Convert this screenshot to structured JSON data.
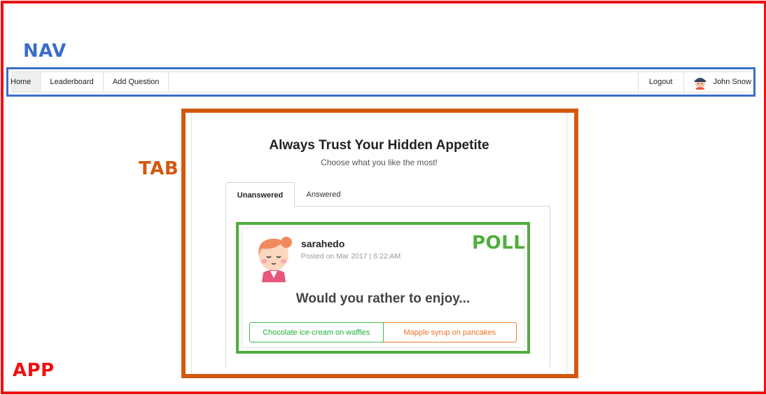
{
  "annotations": {
    "nav": "NAV",
    "tab": "TAB",
    "poll": "POLL",
    "app": "APP"
  },
  "nav": {
    "items": [
      {
        "label": "Home",
        "active": true
      },
      {
        "label": "Leaderboard"
      },
      {
        "label": "Add Question"
      }
    ],
    "logout": "Logout",
    "user": "John Snow"
  },
  "app": {
    "title": "Always Trust Your Hidden Appetite",
    "subtitle": "Choose what you like the most!"
  },
  "tabs": {
    "unanswered": "Unanswered",
    "answered": "Answered",
    "selected": "Unanswered"
  },
  "poll": {
    "author": "sarahedo",
    "posted": "Posted on Mar 2017 | 6:22:AM",
    "question": "Would you rather to enjoy...",
    "option_a": "Chocolate ice-cream on waffles",
    "option_b": "Mapple syrup on pancakes"
  },
  "colors": {
    "app_outline": "#ee1111",
    "nav_outline": "#3b6dc9",
    "tab_outline": "#d4580f",
    "poll_outline": "#4fae3c",
    "option_a": "#22b03a",
    "option_b": "#ec7425"
  }
}
